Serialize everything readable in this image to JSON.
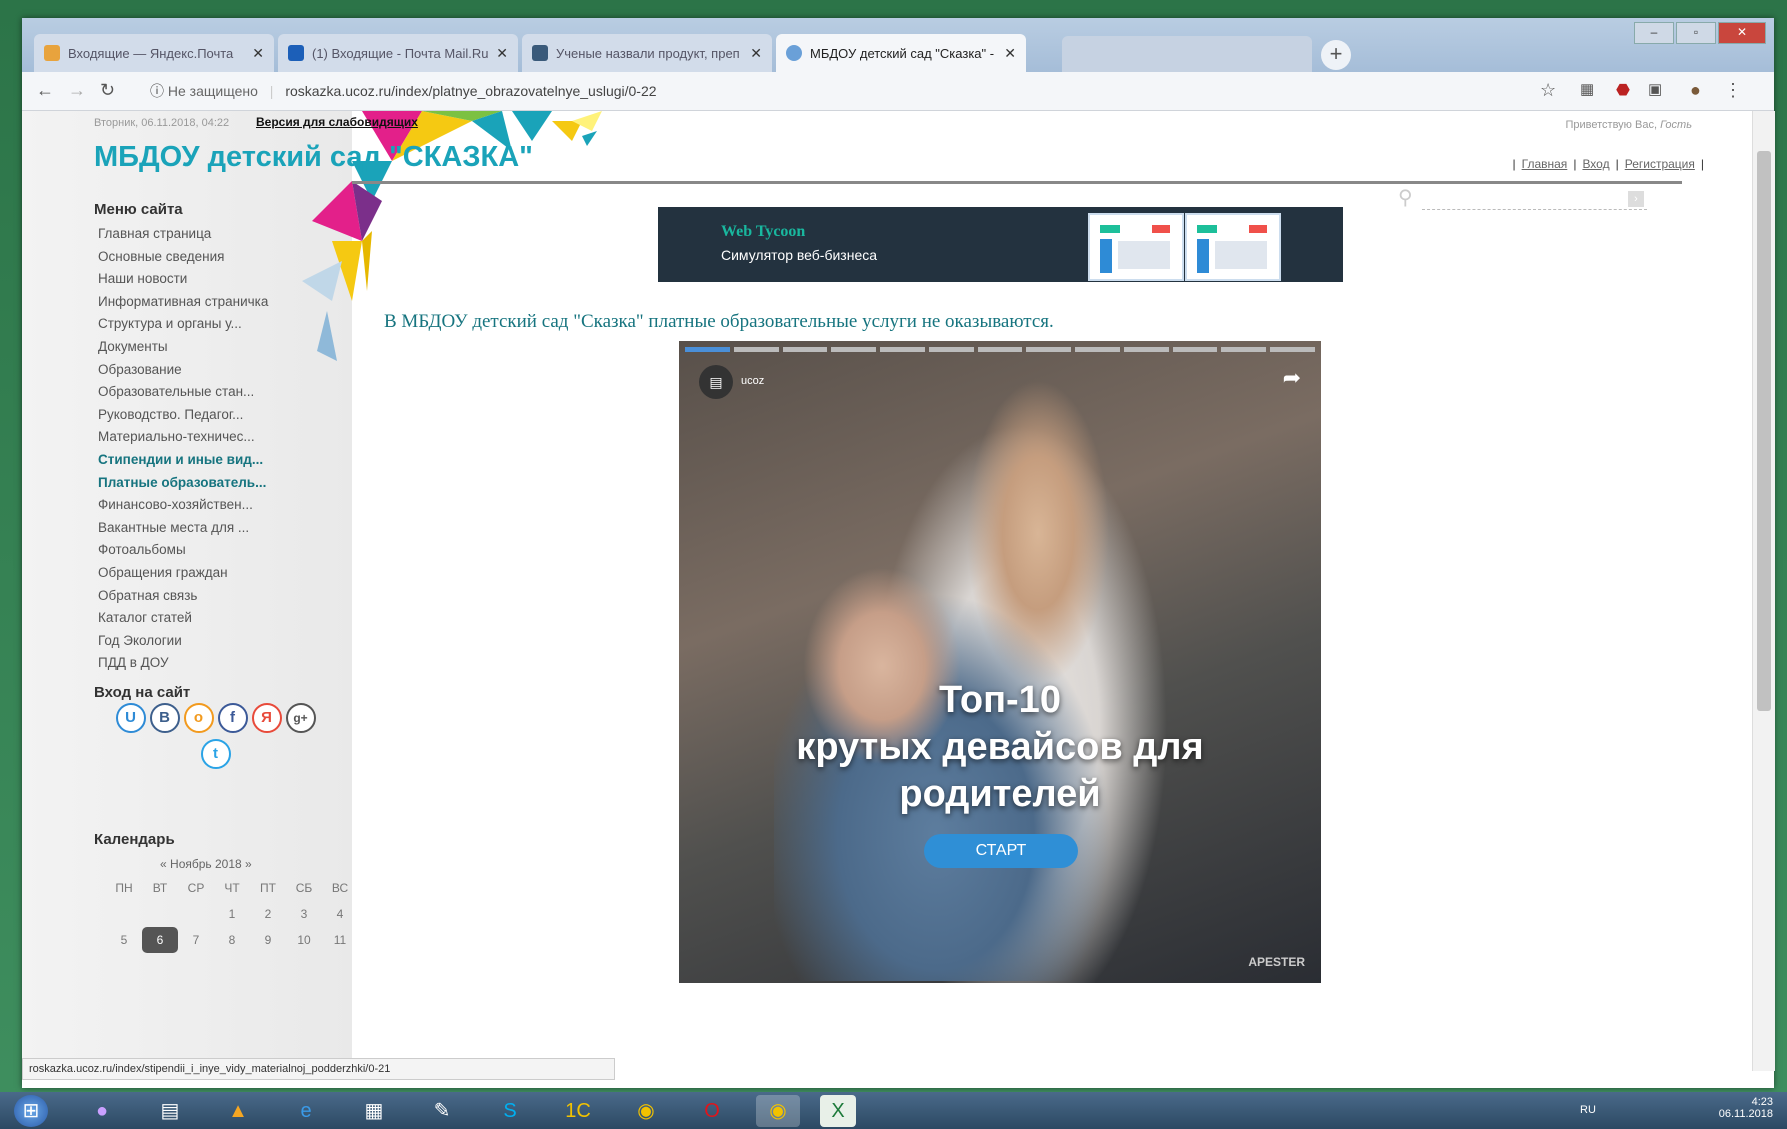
{
  "tabs": [
    {
      "title": "Входящие — Яндекс.Почта",
      "favicon_color": "#e8a33d"
    },
    {
      "title": "(1) Входящие - Почта Mail.Ru",
      "favicon_color": "#1c5fb8"
    },
    {
      "title": "Ученые назвали продукт, преп",
      "favicon_color": "#3a5a7a"
    },
    {
      "title": "МБДОУ детский сад \"Сказка\" - I",
      "favicon_color": "#6aa0d8"
    }
  ],
  "address": {
    "security_label": "Не защищено",
    "url": "roskazka.ucoz.ru/index/platnye_obrazovatelnye_uslugi/0-22"
  },
  "site": {
    "date": "Вторник, 06.11.2018, 04:22",
    "version_link": "Версия для слабовидящих",
    "greeting": "Приветствую Вас,",
    "guest": "Гость",
    "title": "МБДОУ детский сад \"СКАЗКА\"",
    "top_links": [
      "Главная",
      "Вход",
      "Регистрация"
    ]
  },
  "menu": {
    "heading": "Меню сайта",
    "items": [
      "Главная страница",
      "Основные сведения",
      "Наши новости",
      "Информативная страничка",
      "Структура и органы у...",
      "Документы",
      "Образование",
      "Образовательные стан...",
      "Руководство. Педагог...",
      "Материально-техничес...",
      "Стипендии и иные вид...",
      "Платные образователь...",
      "Финансово-хозяйствен...",
      "Вакантные места для ...",
      "Фотоальбомы",
      "Обращения граждан",
      "Обратная связь",
      "Каталог статей",
      "Год Экологии",
      "ПДД в ДОУ"
    ]
  },
  "login": {
    "heading": "Вход на сайт",
    "socials": [
      {
        "glyph": "U",
        "color": "#2e8bd6"
      },
      {
        "glyph": "В",
        "color": "#3d5f8c"
      },
      {
        "glyph": "o",
        "color": "#f29a1e"
      },
      {
        "glyph": "f",
        "color": "#3b5998"
      },
      {
        "glyph": "Я",
        "color": "#e84a3a"
      },
      {
        "glyph": "g+",
        "color": "#555555"
      },
      {
        "glyph": "t",
        "color": "#2aa3e6"
      }
    ]
  },
  "calendar": {
    "heading": "Календарь",
    "prev": "«",
    "month": "Ноябрь 2018",
    "next": "»",
    "weekdays": [
      "ПН",
      "ВТ",
      "СР",
      "ЧТ",
      "ПТ",
      "СБ",
      "ВС"
    ],
    "rows": [
      [
        "",
        "",
        "",
        "1",
        "2",
        "3",
        "4"
      ],
      [
        "5",
        "6",
        "7",
        "8",
        "9",
        "10",
        "11"
      ]
    ],
    "today": "6"
  },
  "banner": {
    "title": "Web Tycoon",
    "subtitle": "Симулятор веб-бизнеса"
  },
  "content": {
    "message": "В МБДОУ детский сад \"Сказка\" платные образовательные услуги не оказываются."
  },
  "video": {
    "brand": "ucoz",
    "headline_1": "Топ-10",
    "headline_2": "крутых девайсов для",
    "headline_3": "родителей",
    "start_label": "СТАРТ",
    "powered": "APESTER",
    "progress_segments": 13,
    "progress_done": 1
  },
  "status_bar": {
    "url": "roskazka.ucoz.ru/index/stipendii_i_inye_vidy_materialnoj_podderzhki/0-21"
  },
  "tray": {
    "lang": "RU",
    "time": "4:23",
    "date": "06.11.2018"
  }
}
